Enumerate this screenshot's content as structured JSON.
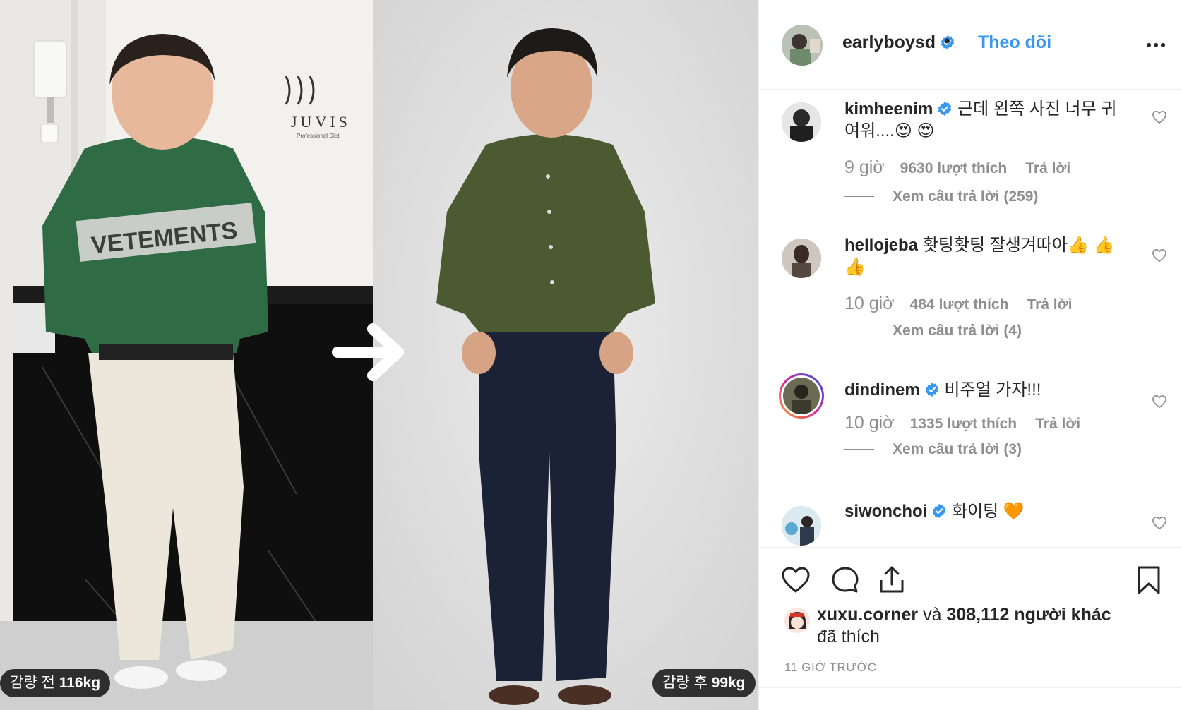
{
  "photo": {
    "left_label": {
      "prefix": "감량 전",
      "value": "116kg"
    },
    "right_label": {
      "prefix": "감량 후",
      "value": "99kg"
    },
    "arrow_icon": "arrow-right-icon",
    "brand_logo_text": "JUVIS",
    "brand_logo_sub": "Professional Diet",
    "sweater_text": "VETEMENTS"
  },
  "header": {
    "username": "earlyboysd",
    "verified": true,
    "separator": "•",
    "follow_label": "Theo dõi",
    "more_icon": "more-options-icon"
  },
  "comments": [
    {
      "username": "kimheenim",
      "verified": true,
      "text": "근데 왼쪽 사진 너무 귀여워....😍 😍",
      "time": "9 giờ",
      "likes": "9630 lượt thích",
      "reply_label": "Trả lời",
      "view_replies": "Xem câu trả lời (259)"
    },
    {
      "username": "hellojeba",
      "verified": false,
      "text": "홧팅홧팅 잘생겨따아👍 👍 👍",
      "time": "10 giờ",
      "likes": "484 lượt thích",
      "reply_label": "Trả lời",
      "view_replies": "Xem câu trả lời (4)"
    },
    {
      "username": "dindinem",
      "verified": true,
      "text": "비주얼 가자!!!",
      "time": "10 giờ",
      "likes": "1335 lượt thích",
      "reply_label": "Trả lời",
      "view_replies": "Xem câu trả lời (3)"
    },
    {
      "username": "siwonchoi",
      "verified": true,
      "text": "화이팅 🧡"
    }
  ],
  "actions": {
    "like_icon": "heart-icon",
    "comment_icon": "comment-icon",
    "share_icon": "share-icon",
    "save_icon": "bookmark-icon",
    "liked_by_user": "xuxu.corner",
    "liked_by_and": "và",
    "liked_by_count": "308,112 người khác",
    "liked_by_suffix": "đã thích",
    "post_time": "11 GIỜ TRƯỚC"
  },
  "colors": {
    "accent": "#3897f0",
    "text": "#262626",
    "muted": "#8e8e8e",
    "border": "#efefef",
    "verified": "#3897f0"
  }
}
